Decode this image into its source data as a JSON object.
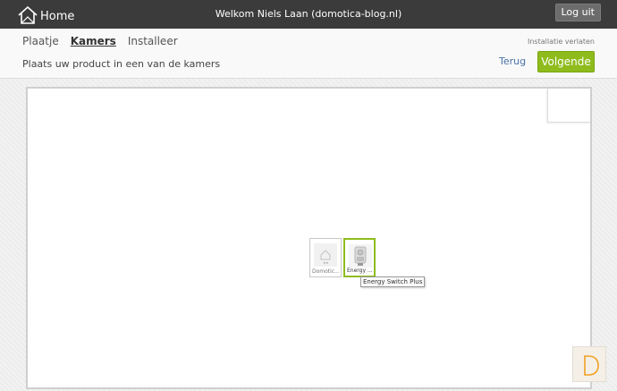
{
  "topbar": {
    "home_label": "Home",
    "welcome_text": "Welkom Niels Laan (domotica-blog.nl)",
    "logout_label": "Log uit"
  },
  "header": {
    "tabs": [
      {
        "label": "Plaatje",
        "active": false
      },
      {
        "label": "Kamers",
        "active": true
      },
      {
        "label": "Installeer",
        "active": false
      }
    ],
    "subtitle": "Plaats uw product in een van de kamers",
    "leave_link": "Installatie verlaten",
    "back_label": "Terug",
    "next_label": "Volgende"
  },
  "products": [
    {
      "label": "Domotic...",
      "icon": "house-device-icon"
    },
    {
      "label": "Energy ...",
      "icon": "energy-switch-plug-icon"
    }
  ],
  "tooltip": "Energy Switch Plus",
  "colors": {
    "topbar": "#3b3b3b",
    "accent_green": "#8fbc1c",
    "link_blue": "#4a72a8",
    "brand_orange": "#f0a020"
  }
}
